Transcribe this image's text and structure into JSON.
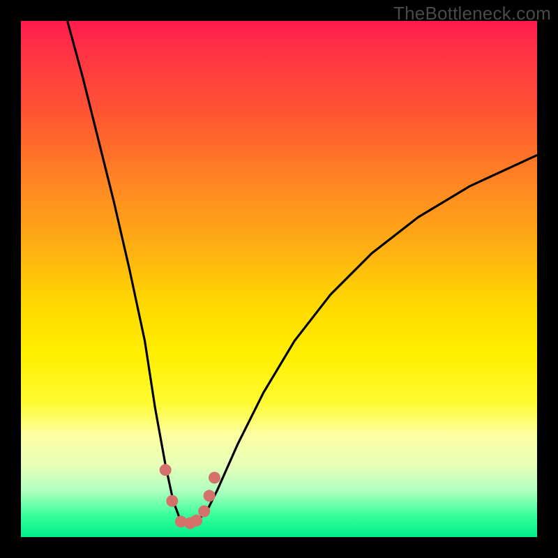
{
  "watermark": "TheBottleneck.com",
  "chart_data": {
    "type": "line",
    "title": "",
    "xlabel": "",
    "ylabel": "",
    "xlim": [
      0,
      100
    ],
    "ylim": [
      0,
      100
    ],
    "series": [
      {
        "name": "bottleneck-curve",
        "x": [
          9,
          12,
          15,
          18,
          21,
          24,
          26,
          28,
          29.5,
          31,
          32.5,
          34,
          36,
          38,
          42,
          47,
          53,
          60,
          68,
          77,
          87,
          100
        ],
        "values": [
          100,
          89,
          77,
          65,
          52,
          38,
          25,
          14,
          7,
          3,
          2.5,
          3,
          5,
          9,
          18,
          28,
          38,
          47,
          55,
          62,
          68,
          74
        ]
      }
    ],
    "markers": {
      "name": "highlight-dots",
      "color": "#d4716a",
      "x": [
        28.0,
        29.3,
        31.0,
        32.8,
        34.0,
        35.5,
        36.5,
        37.5
      ],
      "values": [
        13.0,
        7.0,
        3.0,
        2.7,
        3.2,
        5.0,
        8.0,
        11.5
      ]
    }
  },
  "colors": {
    "curve": "#000000",
    "marker": "#d4716a"
  }
}
